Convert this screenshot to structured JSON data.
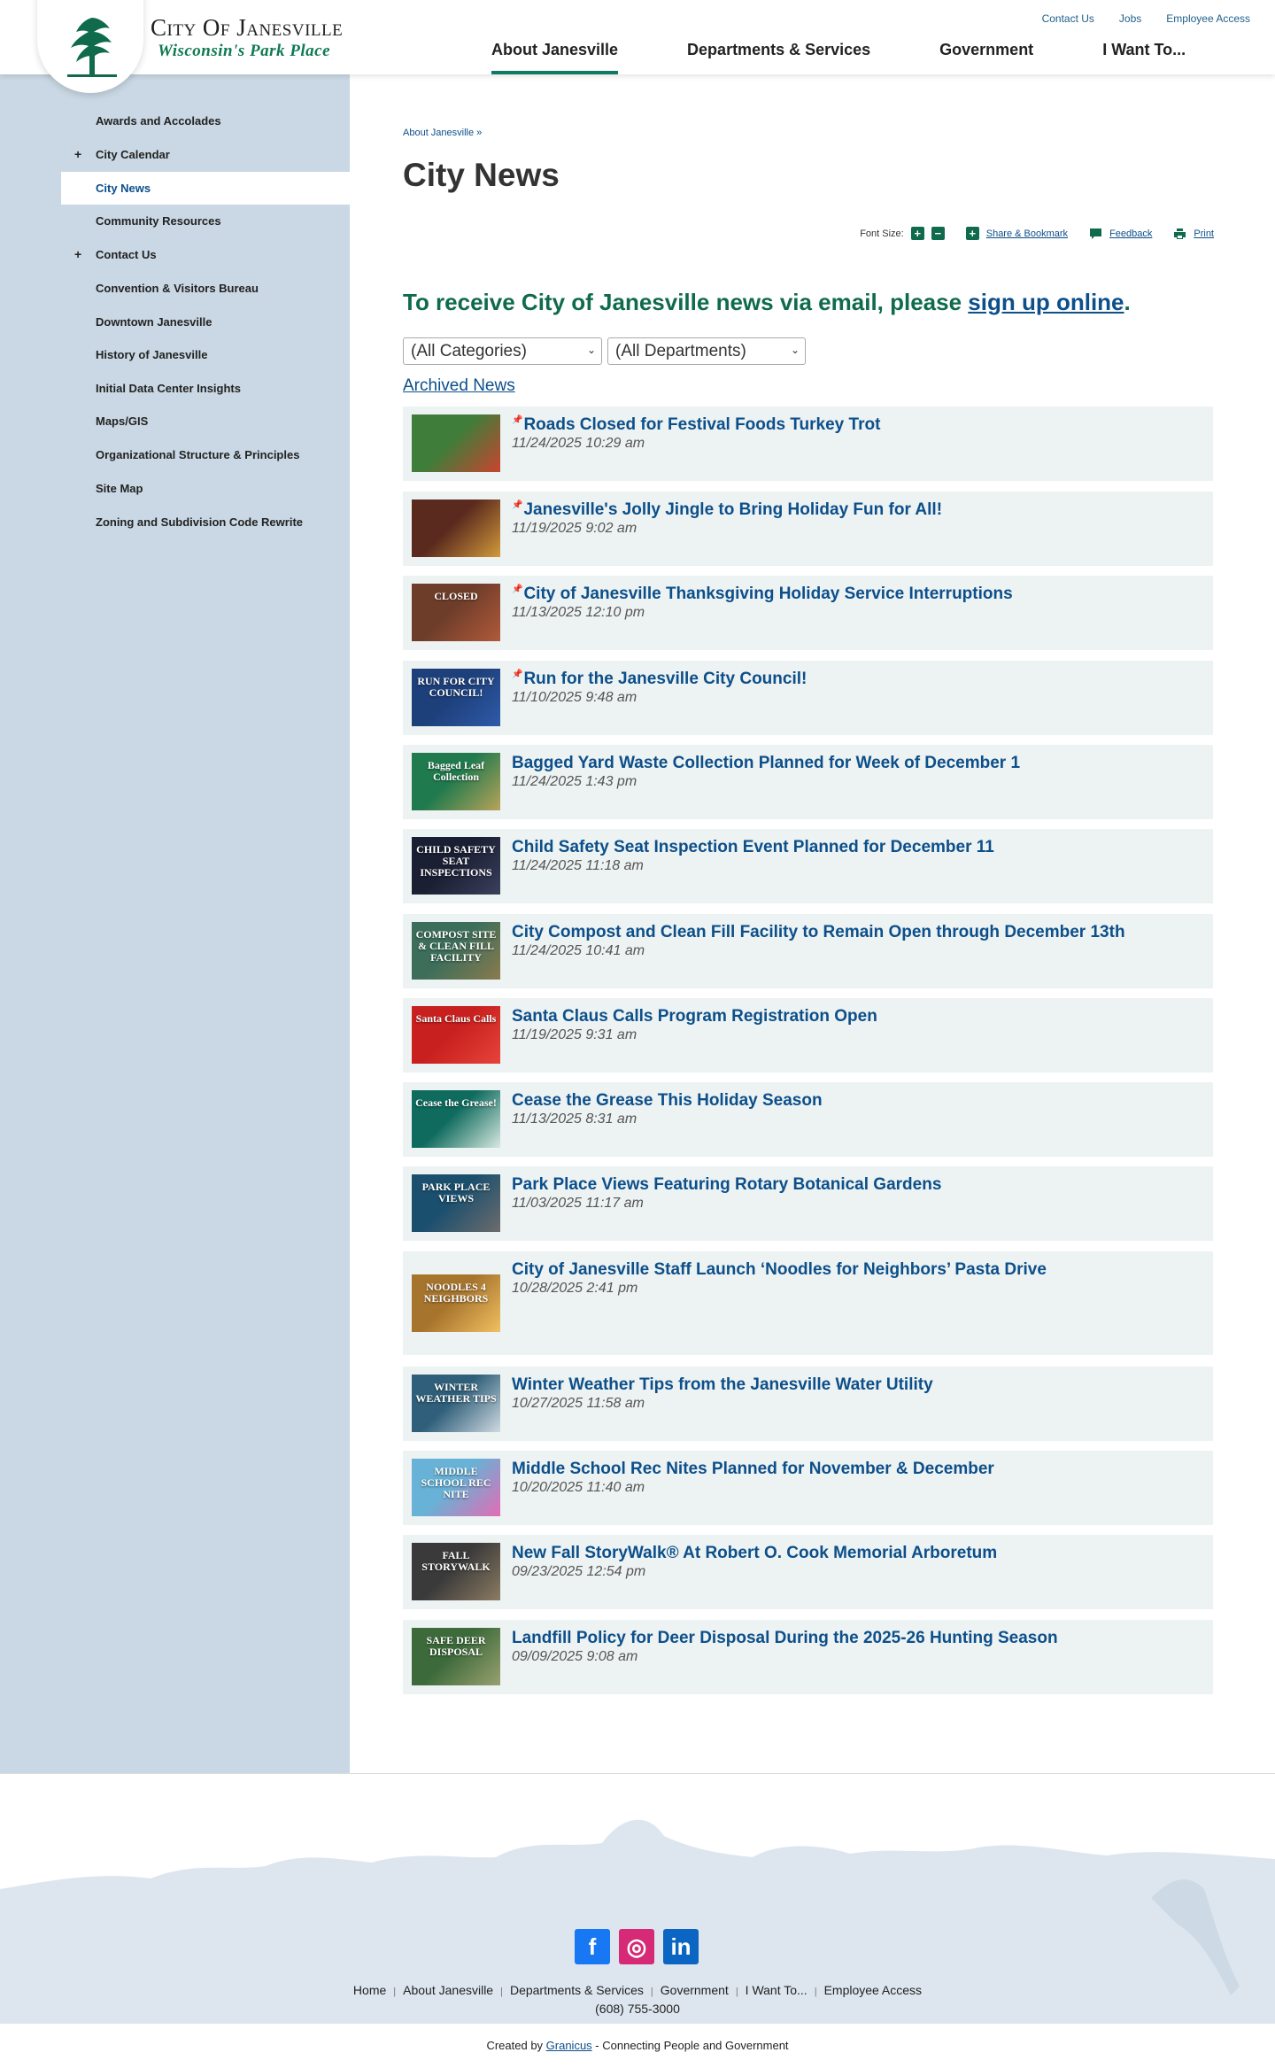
{
  "header": {
    "logo_title": "City Of Janesville",
    "logo_tagline": "Wisconsin's Park Place",
    "util_nav": [
      "Contact Us",
      "Jobs",
      "Employee Access"
    ],
    "main_nav": [
      "About Janesville",
      "Departments & Services",
      "Government",
      "I Want To..."
    ],
    "active_nav": "About Janesville"
  },
  "sidebar": {
    "items": [
      {
        "label": "Awards and Accolades",
        "expand": ""
      },
      {
        "label": "City Calendar",
        "expand": "+"
      },
      {
        "label": "City News",
        "expand": ""
      },
      {
        "label": "Community Resources",
        "expand": ""
      },
      {
        "label": "Contact Us",
        "expand": "+"
      },
      {
        "label": "Convention & Visitors Bureau",
        "expand": ""
      },
      {
        "label": "Downtown Janesville",
        "expand": ""
      },
      {
        "label": "History of Janesville",
        "expand": ""
      },
      {
        "label": "Initial Data Center Insights",
        "expand": ""
      },
      {
        "label": "Maps/GIS",
        "expand": ""
      },
      {
        "label": "Organizational Structure & Principles",
        "expand": ""
      },
      {
        "label": "Site Map",
        "expand": ""
      },
      {
        "label": "Zoning and Subdivision Code Rewrite",
        "expand": ""
      }
    ],
    "active": "City News"
  },
  "content": {
    "breadcrumb": "About Janesville »",
    "title": "City News",
    "tools": {
      "font_size_label": "Font Size:",
      "increase": "+",
      "decrease": "−",
      "share_icon": "+",
      "share": "Share & Bookmark",
      "feedback": "Feedback",
      "print": "Print"
    },
    "signup": {
      "text": "To receive City of Janesville news via email, please ",
      "link": "sign up online",
      "end": "."
    },
    "filters": {
      "category": "(All Categories)",
      "department": "(All Departments)"
    },
    "archived": "Archived News",
    "news": [
      {
        "title": "Roads Closed for Festival Foods Turkey Trot",
        "date": "11/24/2025 10:29 am",
        "pinned": true
      },
      {
        "title": "Janesville's Jolly Jingle to Bring Holiday Fun for All!",
        "date": "11/19/2025 9:02 am",
        "pinned": true
      },
      {
        "title": "City of Janesville Thanksgiving Holiday Service Interruptions",
        "date": "11/13/2025 12:10 pm",
        "pinned": true
      },
      {
        "title": "Run for the Janesville City Council!",
        "date": "11/10/2025 9:48 am",
        "pinned": true
      },
      {
        "title": "Bagged Yard Waste Collection Planned for Week of December 1",
        "date": "11/24/2025 1:43 pm",
        "pinned": false
      },
      {
        "title": "Child Safety Seat Inspection Event Planned for December 11",
        "date": "11/24/2025 11:18 am",
        "pinned": false
      },
      {
        "title": "City Compost and Clean Fill Facility to Remain Open through December 13th",
        "date": "11/24/2025 10:41 am",
        "pinned": false
      },
      {
        "title": "Santa Claus Calls Program Registration Open",
        "date": "11/19/2025 9:31 am",
        "pinned": false
      },
      {
        "title": "Cease the Grease This Holiday Season",
        "date": "11/13/2025 8:31 am",
        "pinned": false
      },
      {
        "title": "Park Place Views Featuring Rotary Botanical Gardens",
        "date": "11/03/2025 11:17 am",
        "pinned": false
      },
      {
        "title": "City of Janesville Staff Launch ‘Noodles for Neighbors’ Pasta Drive",
        "date": "10/28/2025 2:41 pm",
        "pinned": false
      },
      {
        "title": "Winter Weather Tips from the Janesville Water Utility",
        "date": "10/27/2025 11:58 am",
        "pinned": false
      },
      {
        "title": "Middle School Rec Nites Planned for November & December",
        "date": "10/20/2025 11:40 am",
        "pinned": false
      },
      {
        "title": "New Fall StoryWalk® At Robert O. Cook Memorial Arboretum",
        "date": "09/23/2025 12:54 pm",
        "pinned": false
      },
      {
        "title": "Landfill Policy for Deer Disposal During the 2025-26 Hunting Season",
        "date": "09/09/2025 9:08 am",
        "pinned": false
      }
    ],
    "thumbs": [
      {
        "colors": [
          "#3f7d3a",
          "#c9442f"
        ],
        "text": ""
      },
      {
        "colors": [
          "#5a2a1e",
          "#d29a3b"
        ],
        "text": ""
      },
      {
        "colors": [
          "#6e3d2a",
          "#b05a3a"
        ],
        "text": "CLOSED"
      },
      {
        "colors": [
          "#1d3f7a",
          "#2e5aa8"
        ],
        "text": "RUN FOR CITY COUNCIL!"
      },
      {
        "colors": [
          "#1f7a4d",
          "#b9a35a"
        ],
        "text": "Bagged Leaf Collection"
      },
      {
        "colors": [
          "#1a1f33",
          "#3a3f5c"
        ],
        "text": "CHILD SAFETY SEAT INSPECTIONS"
      },
      {
        "colors": [
          "#3c6e5a",
          "#8a7a4e"
        ],
        "text": "COMPOST SITE & CLEAN FILL FACILITY"
      },
      {
        "colors": [
          "#c8201e",
          "#e7433a"
        ],
        "text": "Santa Claus Calls"
      },
      {
        "colors": [
          "#0f6b5e",
          "#d8e8e0"
        ],
        "text": "Cease the Grease!"
      },
      {
        "colors": [
          "#1b4f6e",
          "#6c6c6c"
        ],
        "text": "PARK PLACE VIEWS"
      },
      {
        "colors": [
          "#a7742d",
          "#f0c060"
        ],
        "text": "NOODLES 4 NEIGHBORS"
      },
      {
        "colors": [
          "#2f5f7a",
          "#cfd9e0"
        ],
        "text": "WINTER WEATHER TIPS"
      },
      {
        "colors": [
          "#67b2d6",
          "#e46bb5"
        ],
        "text": "MIDDLE SCHOOL REC NITE"
      },
      {
        "colors": [
          "#3a3a3a",
          "#8c7b62"
        ],
        "text": "FALL STORYWALK"
      },
      {
        "colors": [
          "#3c6a3a",
          "#9aa070"
        ],
        "text": "SAFE DEER DISPOSAL"
      }
    ]
  },
  "footer": {
    "social": [
      {
        "name": "facebook-icon",
        "glyph": "f",
        "color": "#1877f2"
      },
      {
        "name": "instagram-icon",
        "glyph": "◎",
        "color": "#d62976"
      },
      {
        "name": "linkedin-icon",
        "glyph": "in",
        "color": "#0a66c2"
      }
    ],
    "links": [
      "Home",
      "About Janesville",
      "Departments & Services",
      "Government",
      "I Want To...",
      "Employee Access"
    ],
    "phone": "(608) 755-3000",
    "created_prefix": "Created by ",
    "created_link": "Granicus",
    "created_suffix": " - Connecting People and Government"
  },
  "colors": {
    "brand_green": "#0f6b4c",
    "link_blue": "#0c4f8a",
    "sidebar_bg": "#c9d8e4",
    "news_bg": "#edf2f2"
  }
}
